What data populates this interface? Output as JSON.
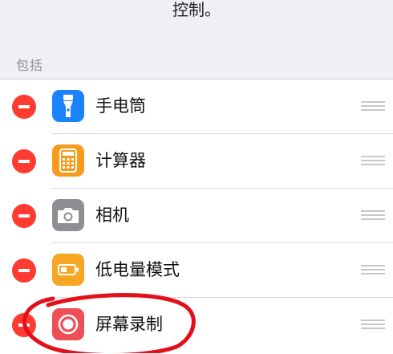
{
  "top_text": "控制。",
  "section_header": "包括",
  "items": [
    {
      "label": "手电筒",
      "icon": "flashlight-icon",
      "icon_color": "#1a82fb"
    },
    {
      "label": "计算器",
      "icon": "calculator-icon",
      "icon_color": "#f89b1c"
    },
    {
      "label": "相机",
      "icon": "camera-icon",
      "icon_color": "#8e8e93"
    },
    {
      "label": "低电量模式",
      "icon": "battery-icon",
      "icon_color": "#f5a623"
    },
    {
      "label": "屏幕录制",
      "icon": "screen-record-icon",
      "icon_color": "#ee4f56"
    }
  ],
  "colors": {
    "remove": "#fd3b31",
    "annotation": "#e3101a",
    "background": "#efeff4"
  }
}
